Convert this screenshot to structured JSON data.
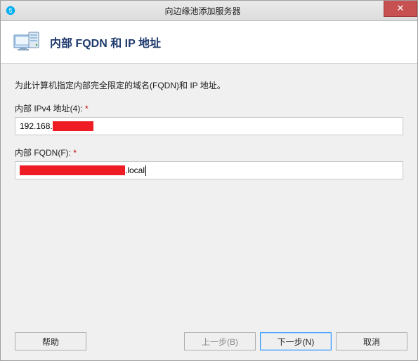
{
  "window": {
    "title": "向边缘池添加服务器"
  },
  "header": {
    "title": "内部 FQDN 和 IP 地址"
  },
  "body": {
    "instruction": "为此计算机指定内部完全限定的域名(FQDN)和 IP 地址。",
    "ipv4_label": "内部 IPv4 地址(4):",
    "ipv4_value_prefix": "192.168.",
    "fqdn_label": "内部 FQDN(F):",
    "fqdn_value_suffix": ".local",
    "required_mark": "*"
  },
  "footer": {
    "help": "帮助",
    "back": "上一步(B)",
    "next": "下一步(N)",
    "cancel": "取消"
  },
  "icons": {
    "app": "skype-icon",
    "header": "server-icon",
    "close": "close-icon"
  }
}
